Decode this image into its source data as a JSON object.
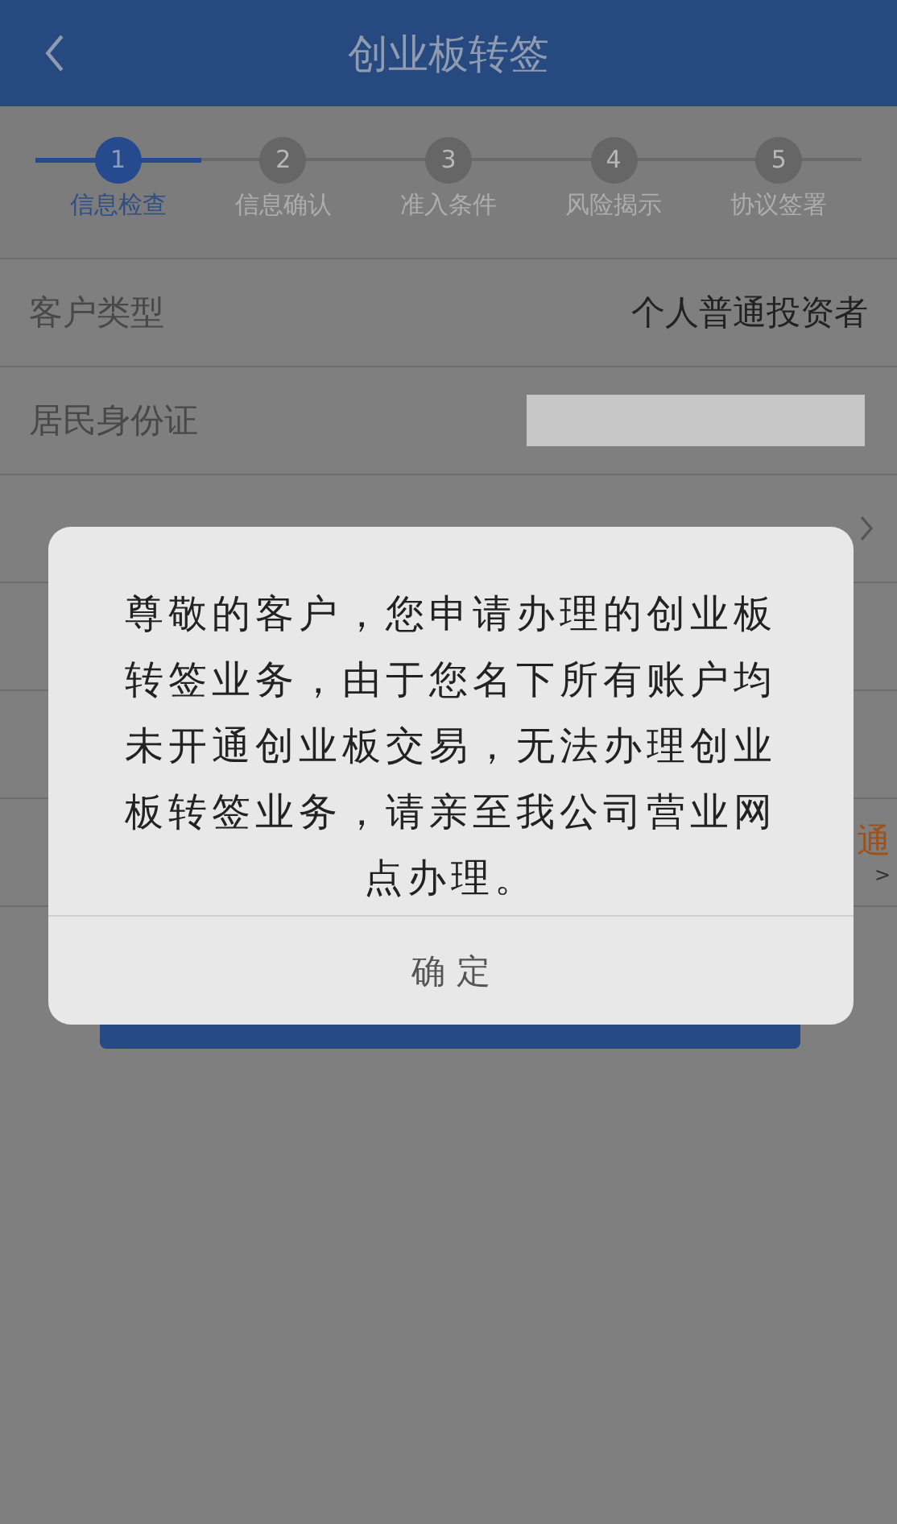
{
  "header": {
    "title": "创业板转签"
  },
  "steps": [
    {
      "number": "1",
      "label": "信息检查",
      "selected": true
    },
    {
      "number": "2",
      "label": "信息确认",
      "selected": false
    },
    {
      "number": "3",
      "label": "准入条件",
      "selected": false
    },
    {
      "number": "4",
      "label": "风险揭示",
      "selected": false
    },
    {
      "number": "5",
      "label": "协议签署",
      "selected": false
    }
  ],
  "rows": [
    {
      "kind": "text",
      "label": "客户类型",
      "value": "个人普通投资者"
    },
    {
      "kind": "masked",
      "label": "居民身份证"
    },
    {
      "kind": "link"
    },
    {
      "kind": "blank"
    },
    {
      "kind": "blank"
    },
    {
      "kind": "action",
      "value": "通",
      "sub": ">"
    }
  ],
  "dialog": {
    "message": "尊敬的客户，您申请办理的创业板转签业务，由于您名下所有账户均未开通创业板交易，无法办理创业板转签业务，请亲至我公司营业网点办理。",
    "button": "确 定"
  }
}
